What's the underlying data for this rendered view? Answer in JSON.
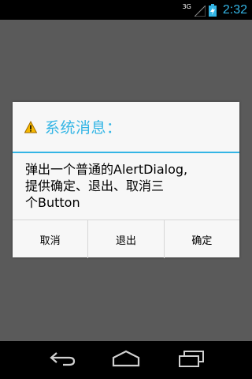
{
  "status_bar": {
    "network": "3G",
    "time": "2:32",
    "icons": [
      "signal-icon",
      "battery-charging-icon"
    ]
  },
  "dialog": {
    "icon": "warning-icon",
    "title": "系统消息：",
    "message_lines": [
      "弹出一个普通的AlertDialog,",
      "提供确定、退出、取消三",
      "个Button"
    ],
    "buttons": {
      "cancel": "取消",
      "exit": "退出",
      "ok": "确定"
    }
  },
  "nav_bar": {
    "icons": [
      "back-icon",
      "home-icon",
      "recent-apps-icon"
    ]
  },
  "colors": {
    "accent": "#33b5e5",
    "scrim": "#5a5a5a",
    "dialog_bg": "#f7f7f7"
  }
}
